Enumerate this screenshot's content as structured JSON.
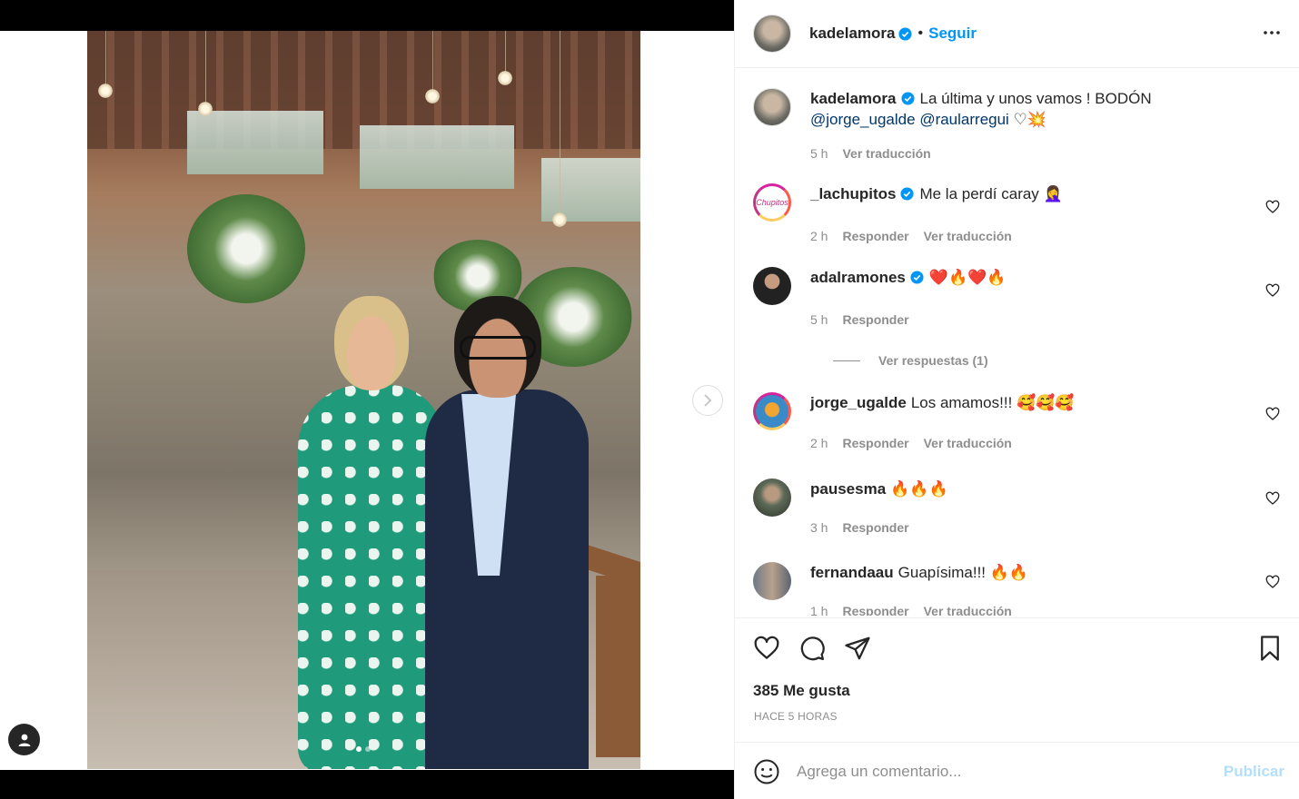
{
  "post": {
    "author": "kadelamora",
    "follow_label": "Seguir",
    "bullet": "•"
  },
  "caption": {
    "username": "kadelamora",
    "text": "La última y unos vamos ! BODÓN",
    "mention1": "@jorge_ugalde",
    "mention2": "@raularregui",
    "emojis": "♡💥",
    "time": "5 h",
    "translate": "Ver traducción"
  },
  "comments": [
    {
      "username": "_lachupitos",
      "verified": true,
      "text": "Me la perdí caray",
      "emoji": "🤦‍♀️",
      "time": "2 h",
      "reply": "Responder",
      "translate": "Ver traducción",
      "avatar_text": "Chupitos"
    },
    {
      "username": "adalramones",
      "verified": true,
      "text": "",
      "emoji": "❤️🔥❤️🔥",
      "time": "5 h",
      "reply": "Responder",
      "translate": "",
      "view_replies": "Ver respuestas (1)"
    },
    {
      "username": "jorge_ugalde",
      "verified": false,
      "text": "Los amamos!!!",
      "emoji": "🥰🥰🥰",
      "time": "2 h",
      "reply": "Responder",
      "translate": "Ver traducción"
    },
    {
      "username": "pausesma",
      "verified": false,
      "text": "",
      "emoji": "🔥🔥🔥",
      "time": "3 h",
      "reply": "Responder",
      "translate": ""
    },
    {
      "username": "fernandaau",
      "verified": false,
      "text": "Guapísima!!!",
      "emoji": "🔥🔥",
      "time": "1 h",
      "reply": "Responder",
      "translate": "Ver traducción"
    }
  ],
  "stats": {
    "likes": "385 Me gusta",
    "posted": "HACE 5 HORAS"
  },
  "composer": {
    "placeholder": "Agrega un comentario...",
    "publish": "Publicar"
  },
  "carousel": {
    "slide_count": 2,
    "active_slide": 1
  },
  "colors": {
    "accent": "#0095f6",
    "mention": "#00376b",
    "muted": "#8e8e8e",
    "publish_disabled": "#b2dffc"
  },
  "icons": [
    "more-options-icon",
    "verified-badge-icon",
    "heart-icon",
    "comment-icon",
    "share-icon",
    "bookmark-icon",
    "emoji-icon",
    "chevron-right-icon",
    "user-tag-icon"
  ]
}
